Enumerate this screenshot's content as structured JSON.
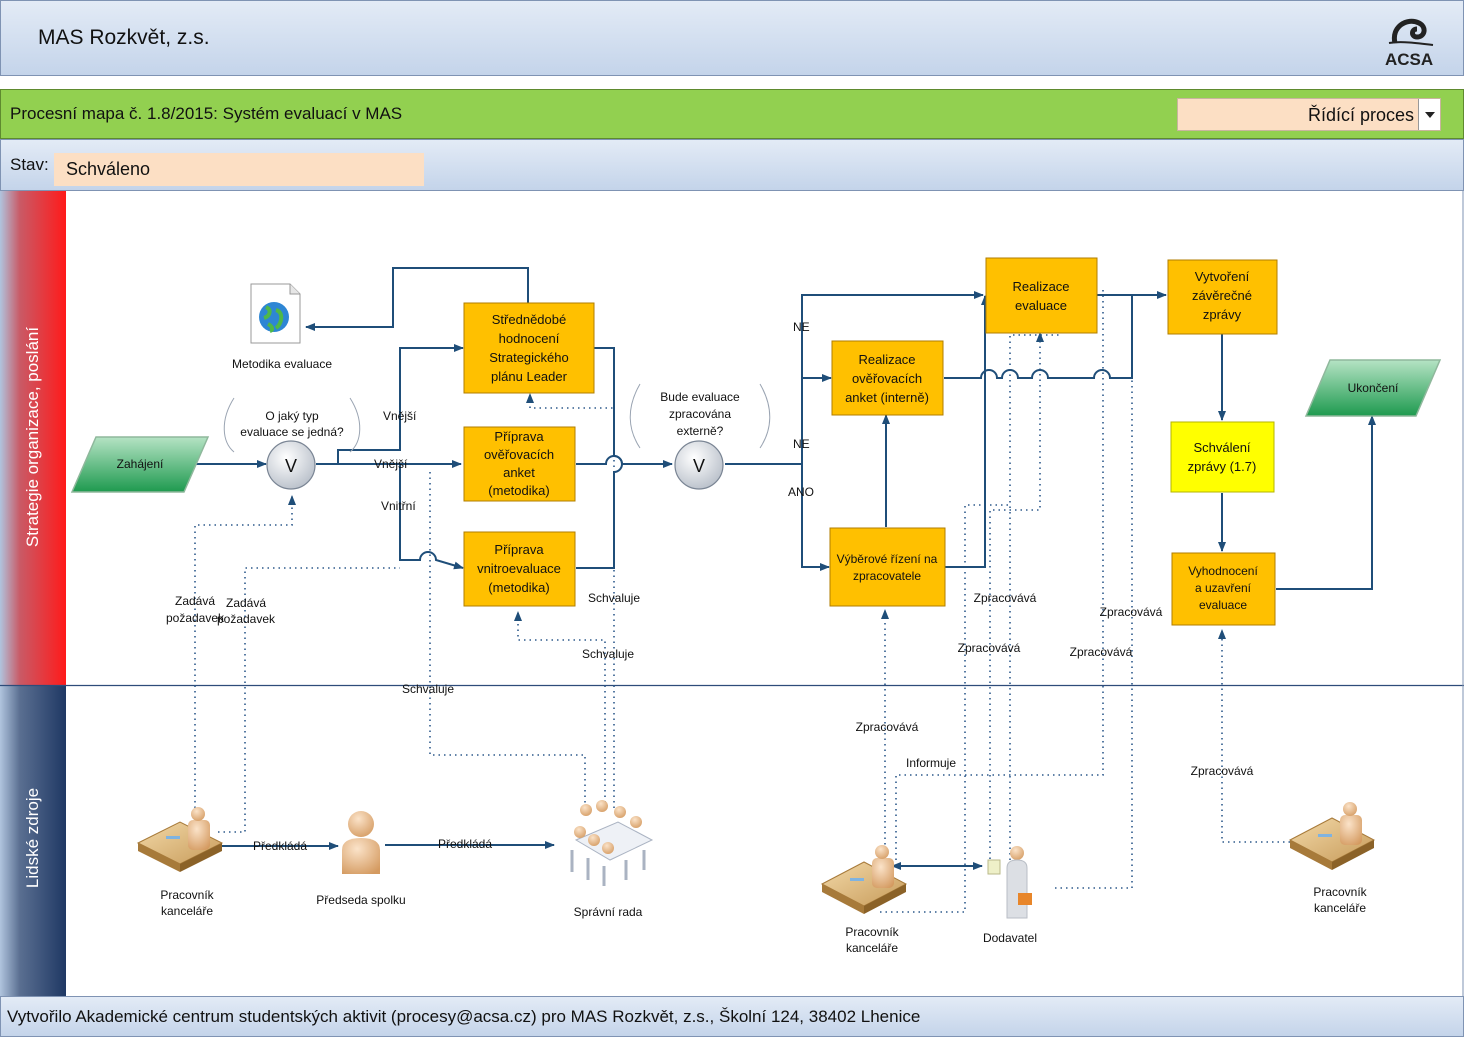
{
  "header": {
    "title": "MAS Rozkvět, z.s.",
    "logo_text": "ACSA"
  },
  "process_bar": {
    "title": "Procesní mapa č. 1.8/2015: Systém evaluací v MAS",
    "process_type": "Řídící proces"
  },
  "status": {
    "label": "Stav:",
    "value": "Schváleno"
  },
  "lanes": {
    "strategy": "Strategie organizace, poslání",
    "people": "Lidské zdroje"
  },
  "footer": {
    "text": "Vytvořilo Akademické centrum studentských aktivit (procesy@acsa.cz) pro MAS Rozkvět, z.s., Školní 124, 38402 Lhenice"
  },
  "nodes": {
    "start": "Zahájení",
    "end": "Ukončení",
    "gateway_symbol": "V",
    "doc": "Metodika evaluace",
    "q1": [
      "O jaký typ",
      "evaluace se jedná?"
    ],
    "q2": [
      "Bude evaluace",
      "zpracována",
      "externě?"
    ],
    "t_mid": [
      "Střednědobé",
      "hodnocení",
      "Strategického",
      "plánu Leader"
    ],
    "t_anket": [
      "Příprava",
      "ověřovacích",
      "anket",
      "(metodika)"
    ],
    "t_vnitro": [
      "Příprava",
      "vnitroevaluace",
      "(metodika)"
    ],
    "t_real_anket": [
      "Realizace",
      "ověřovacích",
      "anket (interně)"
    ],
    "t_vyber": [
      "Výběrové řízení na",
      "zpracovatele"
    ],
    "t_real_eval": [
      "Realizace",
      "evaluace"
    ],
    "t_zaver": [
      "Vytvoření",
      "závěrečné",
      "zprávy"
    ],
    "t_schvaleni": [
      "Schválení",
      "zprávy (1.7)"
    ],
    "t_vyhod": [
      "Vyhodnocení",
      "a uzavření",
      "evaluace"
    ]
  },
  "edge_labels": {
    "vnejsi": "Vnější",
    "vnitrni": "Vnitřní",
    "ne": "NE",
    "ano": "ANO",
    "zadava": [
      "Zadává",
      "požadavek"
    ],
    "schvaluje": "Schvaluje",
    "zpracovava": "Zpracovává",
    "predklada": "Předkládá",
    "informuje": "Informuje"
  },
  "actors": {
    "pracovnik": [
      "Pracovník",
      "kanceláře"
    ],
    "predseda": "Předseda spolku",
    "rada": "Správní rada",
    "dodavatel": "Dodavatel"
  },
  "colors": {
    "task": "#ffc000",
    "task_yellow": "#ffff00",
    "green_bar": "#92d050",
    "flow": "#1f4e79"
  }
}
